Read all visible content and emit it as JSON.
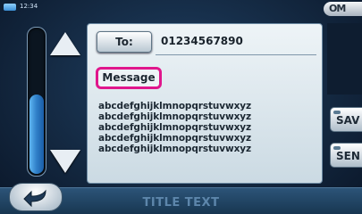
{
  "status": {
    "time": "12:34",
    "top_button_label": "OM"
  },
  "recipient": {
    "to_label": "To:",
    "number": "01234567890"
  },
  "message": {
    "label": "Message",
    "lines": [
      "abcdefghijklmnopqrstuvwxyz",
      "abcdefghijklmnopqrstuvwxyz",
      "abcdefghijklmnopqrstuvwxyz",
      "abcdefghijklmnopqrstuvwxyz",
      "abcdefghijklmnopqrstuvwxyz"
    ]
  },
  "actions": {
    "save_label": "SAV",
    "send_label": "SEN"
  },
  "footer": {
    "title": "TITLE TEXT"
  },
  "scroll": {
    "level": 0.55
  },
  "colors": {
    "highlight": "#e0168c",
    "scroll_fill": "#2f7fc8"
  },
  "icons": {
    "back": "back-arrow-icon",
    "up": "arrow-up-icon",
    "down": "arrow-down-icon",
    "signal": "signal-icon"
  }
}
